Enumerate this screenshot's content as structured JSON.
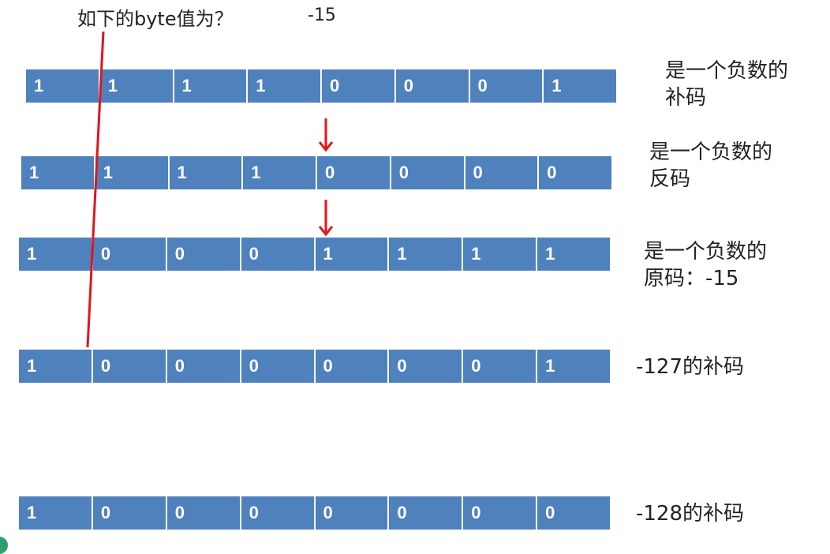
{
  "header": {
    "question": "如下的byte值为？",
    "answer": "-15"
  },
  "rows": [
    {
      "bits": [
        "1",
        "1",
        "1",
        "1",
        "0",
        "0",
        "0",
        "1"
      ],
      "label_line1": "是一个负数的",
      "label_line2": "补码"
    },
    {
      "bits": [
        "1",
        "1",
        "1",
        "1",
        "0",
        "0",
        "0",
        "0"
      ],
      "label_line1": "是一个负数的",
      "label_line2": "反码"
    },
    {
      "bits": [
        "1",
        "0",
        "0",
        "0",
        "1",
        "1",
        "1",
        "1"
      ],
      "label_line1": "是一个负数的",
      "label_line2": "原码：-15"
    },
    {
      "bits": [
        "1",
        "0",
        "0",
        "0",
        "0",
        "0",
        "0",
        "1"
      ],
      "label_line1": "-127的补码",
      "label_line2": ""
    },
    {
      "bits": [
        "1",
        "0",
        "0",
        "0",
        "0",
        "0",
        "0",
        "0"
      ],
      "label_line1": "-128的补码",
      "label_line2": ""
    }
  ],
  "colors": {
    "bit_box": "#4f81bd",
    "arrow": "#e3141b"
  },
  "icons": [
    "down-arrow-icon",
    "down-arrow-icon"
  ]
}
